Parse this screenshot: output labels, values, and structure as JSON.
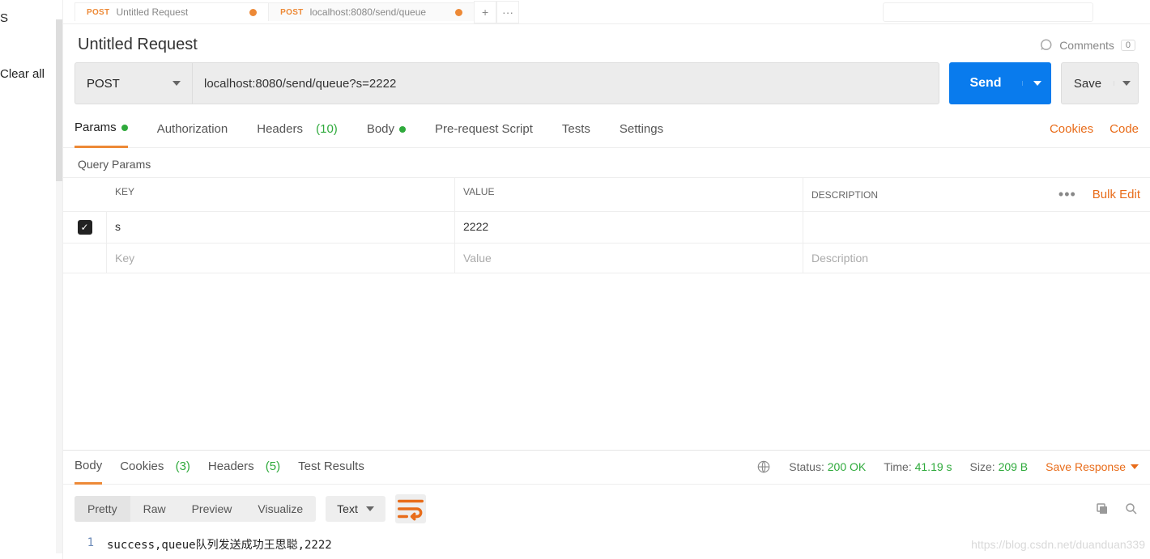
{
  "sidebar": {
    "label_s": "S",
    "clear_all": "Clear all"
  },
  "tabs": {
    "items": [
      {
        "method": "POST",
        "title": "Untitled Request"
      },
      {
        "method": "POST",
        "title": "localhost:8080/send/queue"
      }
    ],
    "plus": "+",
    "more": "···"
  },
  "header": {
    "title": "Untitled Request",
    "comments_label": "Comments",
    "comments_count": "0"
  },
  "url_row": {
    "method": "POST",
    "url": "localhost:8080/send/queue?s=2222",
    "send": "Send",
    "save": "Save"
  },
  "req_tabs": {
    "params": "Params",
    "authorization": "Authorization",
    "headers": "Headers",
    "headers_count": "(10)",
    "body": "Body",
    "prescript": "Pre-request Script",
    "tests": "Tests",
    "settings": "Settings",
    "cookies": "Cookies",
    "code": "Code"
  },
  "params": {
    "section": "Query Params",
    "key_h": "KEY",
    "value_h": "VALUE",
    "desc_h": "DESCRIPTION",
    "bulk_edit": "Bulk Edit",
    "rows": [
      {
        "key": "s",
        "value": "2222",
        "desc": ""
      }
    ],
    "ph_key": "Key",
    "ph_value": "Value",
    "ph_desc": "Description"
  },
  "resp_tabs": {
    "body": "Body",
    "cookies": "Cookies",
    "cookies_count": "(3)",
    "headers": "Headers",
    "headers_count": "(5)",
    "tests": "Test Results"
  },
  "resp_meta": {
    "status_label": "Status:",
    "status_value": "200 OK",
    "time_label": "Time:",
    "time_value": "41.19 s",
    "size_label": "Size:",
    "size_value": "209 B",
    "save_response": "Save Response"
  },
  "resp_toolbar": {
    "pretty": "Pretty",
    "raw": "Raw",
    "preview": "Preview",
    "visualize": "Visualize",
    "format": "Text"
  },
  "resp_body": {
    "line_num": "1",
    "content": "success,queue队列发送成功王思聪,2222"
  },
  "watermark": "https://blog.csdn.net/duanduan339"
}
